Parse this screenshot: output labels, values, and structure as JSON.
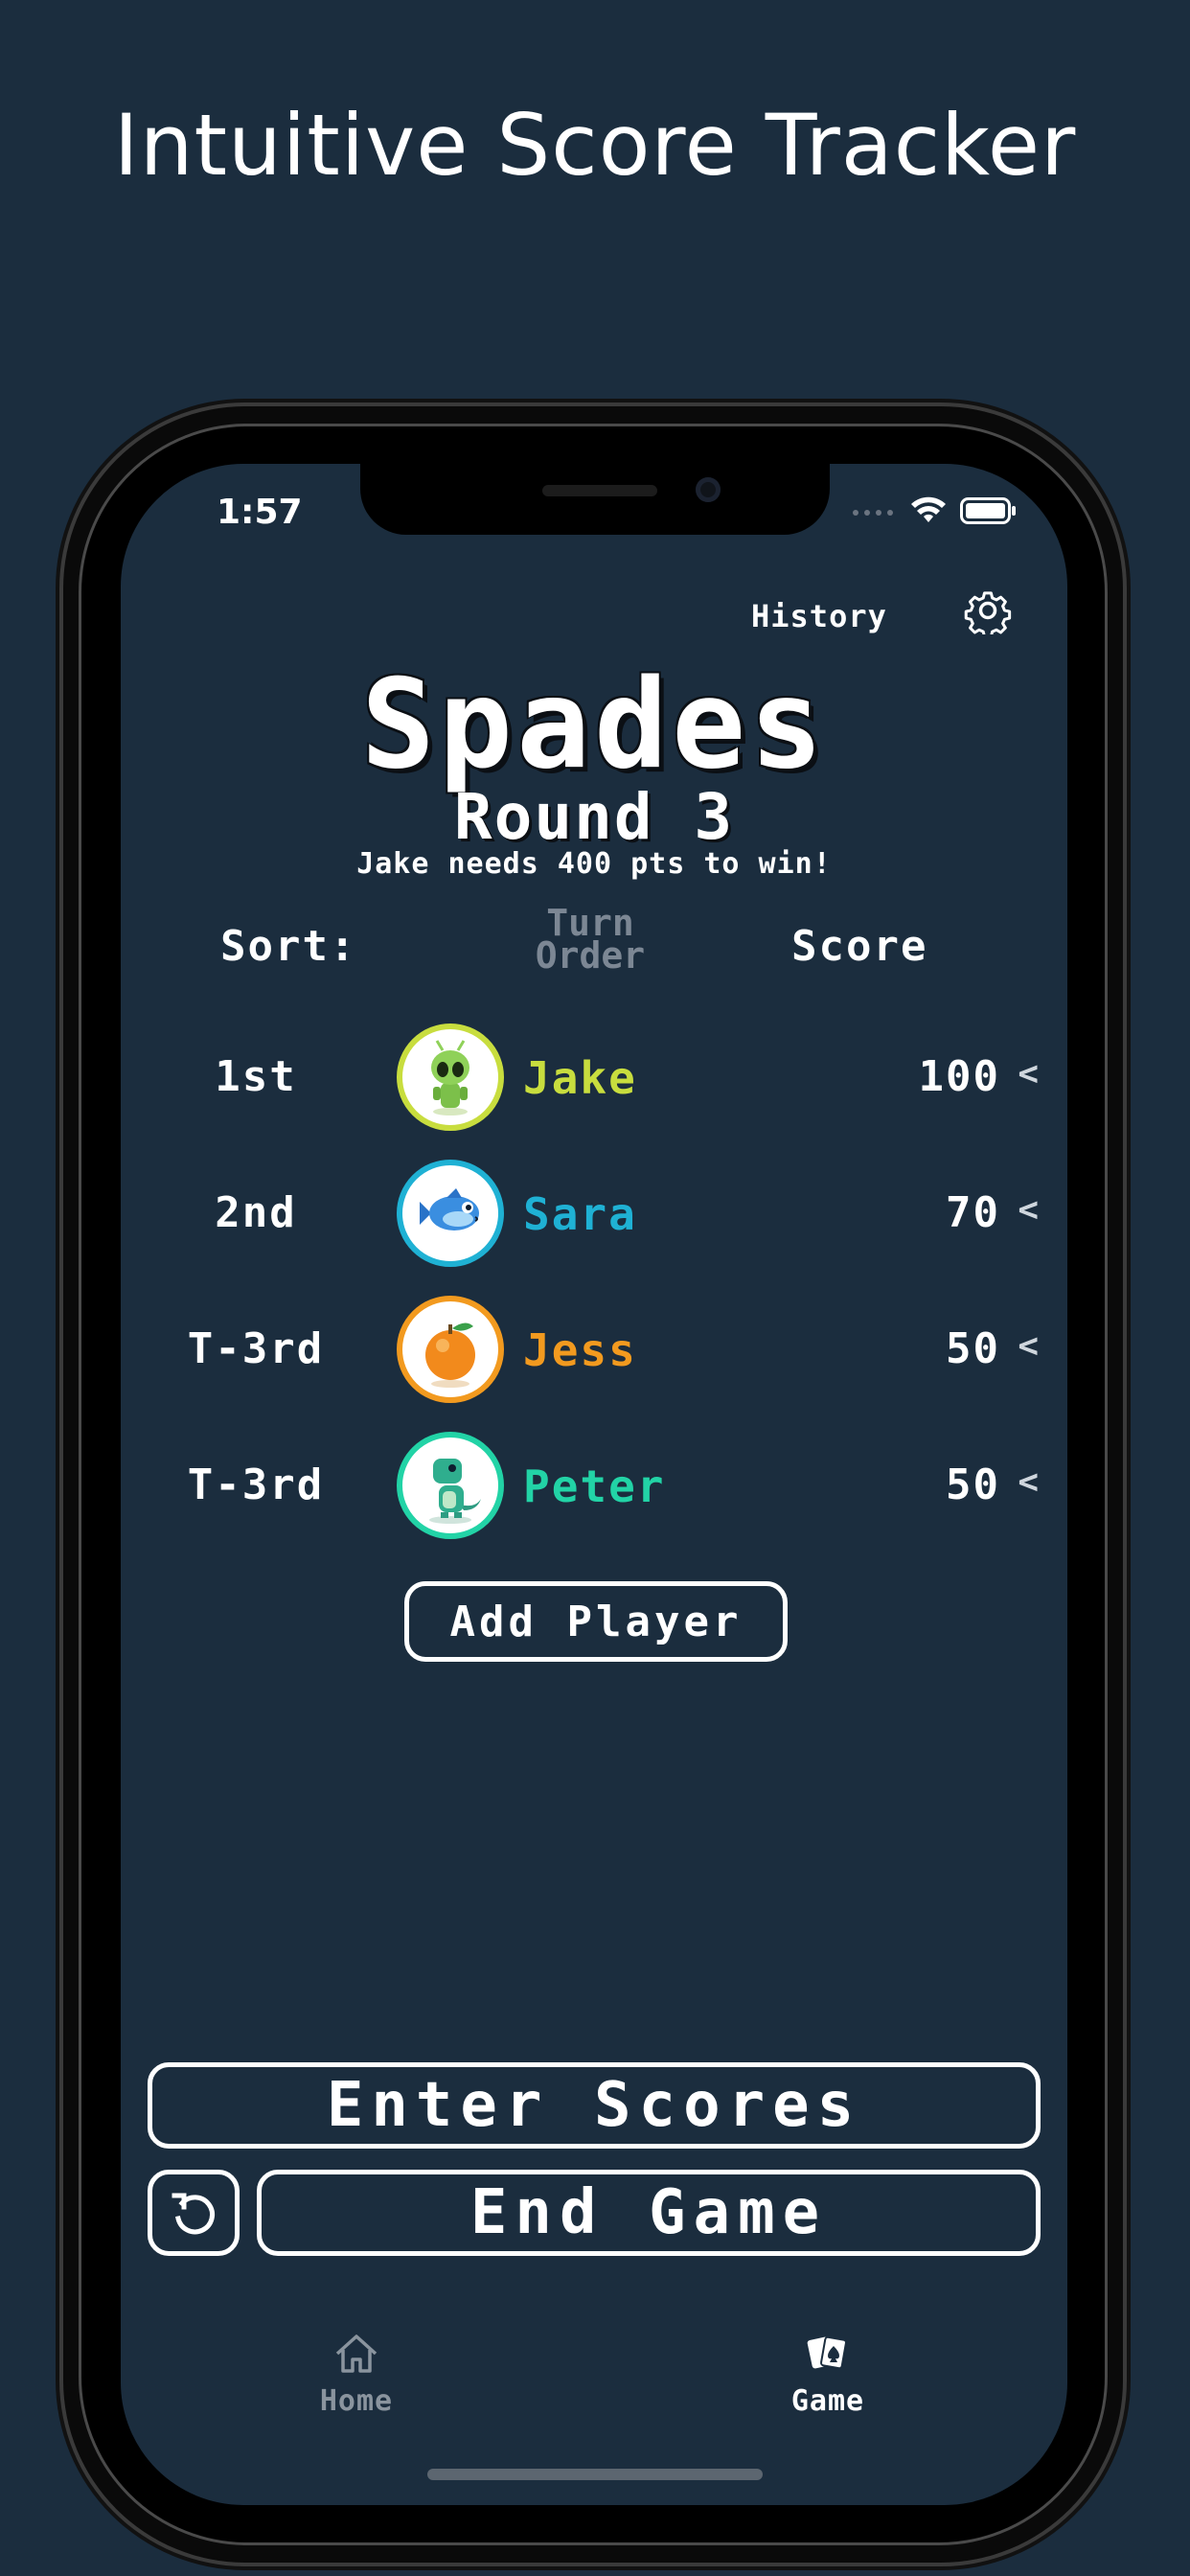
{
  "headline": "Intuitive Score Tracker",
  "status_bar": {
    "time": "1:57"
  },
  "header": {
    "history_label": "History",
    "settings_icon": "gear-icon"
  },
  "game": {
    "title": "Spades",
    "round": "Round 3",
    "subtitle": "Jake needs 400 pts to win!"
  },
  "sort": {
    "label": "Sort:",
    "turn_order": "Turn Order",
    "score": "Score"
  },
  "players": [
    {
      "rank": "1st",
      "name": "Jake",
      "score": "100",
      "color": "#c8dd3e",
      "avatar": "alien-avatar-icon"
    },
    {
      "rank": "2nd",
      "name": "Sara",
      "score": "70",
      "color": "#1fb1d4",
      "avatar": "fish-avatar-icon"
    },
    {
      "rank": "T-3rd",
      "name": "Jess",
      "score": "50",
      "color": "#f29a1f",
      "avatar": "orange-avatar-icon"
    },
    {
      "rank": "T-3rd",
      "name": "Peter",
      "score": "50",
      "color": "#22d3a6",
      "avatar": "dinosaur-avatar-icon"
    }
  ],
  "actions": {
    "add_player": "Add Player",
    "enter_scores": "Enter Scores",
    "end_game": "End Game",
    "undo_icon": "undo-icon"
  },
  "tabbar": {
    "home": {
      "label": "Home",
      "icon": "house-icon"
    },
    "game": {
      "label": "Game",
      "icon": "cards-icon"
    }
  }
}
